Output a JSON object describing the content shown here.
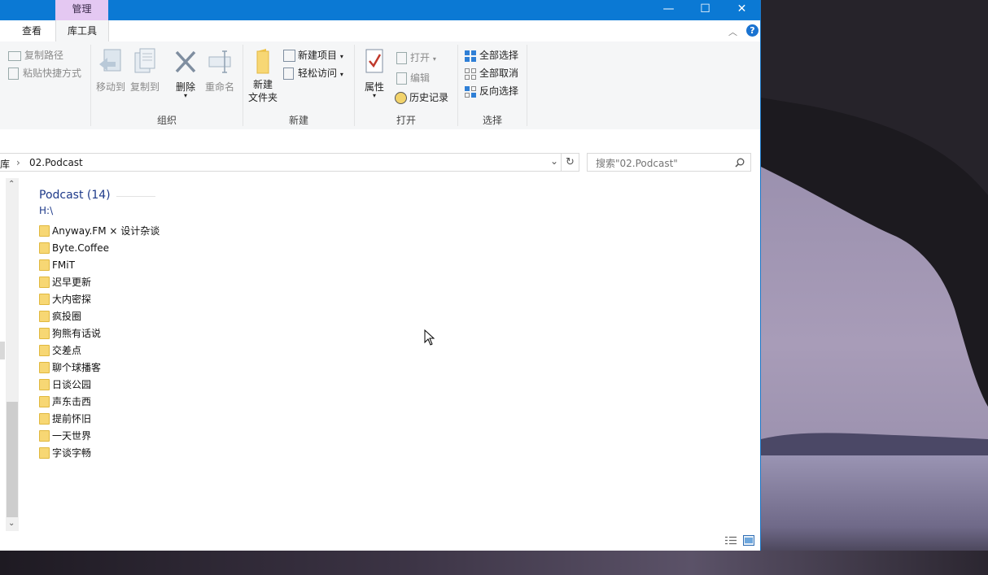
{
  "titlebar": {
    "context_tab": "管理",
    "minimize": "—",
    "maximize": "☐",
    "close": "✕"
  },
  "tabs": [
    {
      "label": "查看"
    },
    {
      "label": "库工具"
    }
  ],
  "ribbon": {
    "clipboard": {
      "copy_path": "复制路径",
      "paste_shortcut": "粘贴快捷方式"
    },
    "organize": {
      "label": "组织",
      "move_to": "移动到",
      "copy_to": "复制到",
      "delete": "删除",
      "rename": "重命名"
    },
    "new": {
      "label": "新建",
      "new_folder_line1": "新建",
      "new_folder_line2": "文件夹",
      "new_item": "新建项目",
      "easy_access": "轻松访问"
    },
    "open": {
      "label": "打开",
      "properties": "属性",
      "open": "打开",
      "edit": "编辑",
      "history": "历史记录"
    },
    "select": {
      "label": "选择",
      "select_all": "全部选择",
      "select_none": "全部取消",
      "invert": "反向选择"
    }
  },
  "address": {
    "prefix": "库",
    "separator": "›",
    "current": "02.Podcast"
  },
  "search": {
    "placeholder": "搜索\"02.Podcast\""
  },
  "group": {
    "title": "Podcast (14)",
    "path": "H:\\"
  },
  "folders": [
    "Anyway.FM × 设计杂谈",
    "Byte.Coffee",
    "FMiT",
    "迟早更新",
    "大内密探",
    "疯投圈",
    "狗熊有话说",
    "交差点",
    "聊个球播客",
    "日谈公园",
    "声东击西",
    "提前怀旧",
    "一天世界",
    "字谈字畅"
  ]
}
